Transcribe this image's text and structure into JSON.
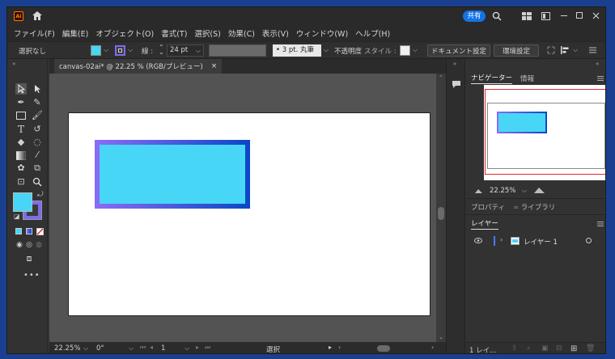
{
  "titlebar": {
    "share_label": "共有"
  },
  "menu": [
    "ファイル(F)",
    "編集(E)",
    "オブジェクト(O)",
    "書式(T)",
    "選択(S)",
    "効果(C)",
    "表示(V)",
    "ウィンドウ(W)",
    "ヘルプ(H)"
  ],
  "control": {
    "selection_label": "選択なし",
    "fill_color": "#47d6f5",
    "stroke_color": "#7b6cf0",
    "stroke_label": "線 :",
    "stroke_weight": "24 pt",
    "brush_label": "3 pt. 丸筆",
    "opacity_label": "不透明度",
    "style_label": "スタイル :",
    "doc_settings_label": "ドキュメント設定",
    "prefs_label": "環境設定"
  },
  "document": {
    "tab_title": "canvas-02ai* @ 22.25 % (RGB/プレビュー)",
    "status_zoom": "22.25%",
    "status_angle": "0°",
    "status_page": "1",
    "status_tool": "選択"
  },
  "artwork": {
    "rect_fill": "#47d6f5",
    "gradient_start": "#8c6cf5",
    "gradient_end": "#0a47c8"
  },
  "navigator": {
    "tab_navigator": "ナビゲーター",
    "tab_info": "情報",
    "zoom": "22.25%",
    "viewport_color": "#e0282e"
  },
  "properties": {
    "tab_properties": "プロパティ",
    "tab_libraries": "ライブラリ"
  },
  "layers": {
    "tab_layers": "レイヤー",
    "layer_name": "レイヤー 1",
    "layer_color": "#4a7bff",
    "footer_count": "1 レイ..."
  }
}
